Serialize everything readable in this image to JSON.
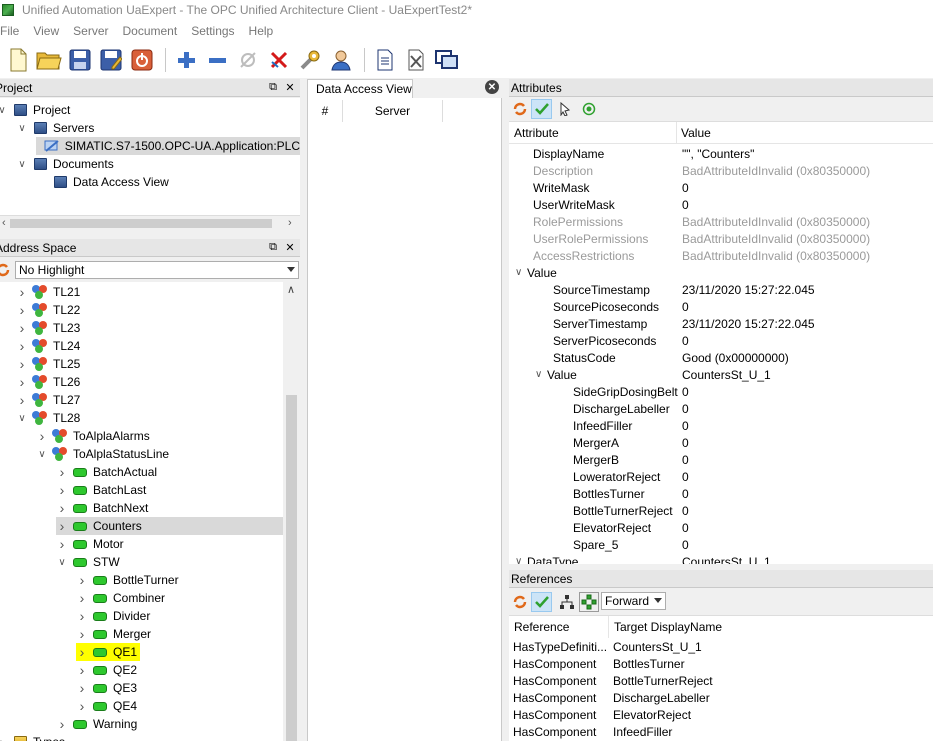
{
  "window": {
    "title": "Unified Automation UaExpert - The OPC Unified Architecture Client - UaExpertTest2*"
  },
  "menu": [
    "File",
    "View",
    "Server",
    "Document",
    "Settings",
    "Help"
  ],
  "toolbar": {
    "icons": [
      "new-document-icon",
      "open-folder-icon",
      "save-icon",
      "save-as-icon",
      "quit-icon",
      "add-server-icon",
      "remove-server-icon",
      "connect-icon",
      "disconnect-icon",
      "settings-wrench-icon",
      "user-icon",
      "document-properties-icon",
      "delete-document-icon",
      "windows-icon"
    ]
  },
  "project": {
    "title": "Project",
    "rows": [
      {
        "label": "Project",
        "level": 0,
        "expanded": true
      },
      {
        "label": "Servers",
        "level": 1,
        "expanded": true
      },
      {
        "label": "SIMATIC.S7-1500.OPC-UA.Application:PLC",
        "level": 2,
        "selected": true
      },
      {
        "label": "Documents",
        "level": 1,
        "expanded": true
      },
      {
        "label": "Data Access View",
        "level": 2
      }
    ]
  },
  "address_space": {
    "title": "Address Space",
    "highlight": "No Highlight",
    "rows": [
      {
        "label": "TL21",
        "level": 1,
        "type": "object"
      },
      {
        "label": "TL22",
        "level": 1,
        "type": "object"
      },
      {
        "label": "TL23",
        "level": 1,
        "type": "object"
      },
      {
        "label": "TL24",
        "level": 1,
        "type": "object"
      },
      {
        "label": "TL25",
        "level": 1,
        "type": "object"
      },
      {
        "label": "TL26",
        "level": 1,
        "type": "object"
      },
      {
        "label": "TL27",
        "level": 1,
        "type": "object"
      },
      {
        "label": "TL28",
        "level": 1,
        "type": "object",
        "expanded": true
      },
      {
        "label": "ToAlplaAlarms",
        "level": 2,
        "type": "object"
      },
      {
        "label": "ToAlplaStatusLine",
        "level": 2,
        "type": "object",
        "expanded": true
      },
      {
        "label": "BatchActual",
        "level": 3,
        "type": "variable"
      },
      {
        "label": "BatchLast",
        "level": 3,
        "type": "variable"
      },
      {
        "label": "BatchNext",
        "level": 3,
        "type": "variable"
      },
      {
        "label": "Counters",
        "level": 3,
        "type": "variable",
        "selected": true
      },
      {
        "label": "Motor",
        "level": 3,
        "type": "variable"
      },
      {
        "label": "STW",
        "level": 3,
        "type": "variable",
        "expanded": true
      },
      {
        "label": "BottleTurner",
        "level": 4,
        "type": "variable"
      },
      {
        "label": "Combiner",
        "level": 4,
        "type": "variable"
      },
      {
        "label": "Divider",
        "level": 4,
        "type": "variable"
      },
      {
        "label": "Merger",
        "level": 4,
        "type": "variable"
      },
      {
        "label": "QE1",
        "level": 4,
        "type": "variable",
        "highlighted": true
      },
      {
        "label": "QE2",
        "level": 4,
        "type": "variable"
      },
      {
        "label": "QE3",
        "level": 4,
        "type": "variable"
      },
      {
        "label": "QE4",
        "level": 4,
        "type": "variable"
      },
      {
        "label": "Warning",
        "level": 3,
        "type": "variable"
      },
      {
        "label": "Types",
        "level": 0,
        "type": "folder"
      }
    ]
  },
  "data_access": {
    "tab": "Data Access View",
    "columns": [
      "#",
      "Server"
    ]
  },
  "attributes": {
    "title": "Attributes",
    "col_attribute": "Attribute",
    "col_value": "Value",
    "rows": [
      {
        "name": "DisplayName",
        "value": "\"\", \"Counters\"",
        "indent": 0
      },
      {
        "name": "Description",
        "value": "BadAttributeIdInvalid (0x80350000)",
        "indent": 0,
        "grey": true
      },
      {
        "name": "WriteMask",
        "value": "0",
        "indent": 0
      },
      {
        "name": "UserWriteMask",
        "value": "0",
        "indent": 0
      },
      {
        "name": "RolePermissions",
        "value": "BadAttributeIdInvalid (0x80350000)",
        "indent": 0,
        "grey": true
      },
      {
        "name": "UserRolePermissions",
        "value": "BadAttributeIdInvalid (0x80350000)",
        "indent": 0,
        "grey": true
      },
      {
        "name": "AccessRestrictions",
        "value": "BadAttributeIdInvalid (0x80350000)",
        "indent": 0,
        "grey": true
      },
      {
        "name": "Value",
        "value": "",
        "indent": 0,
        "group": true
      },
      {
        "name": "SourceTimestamp",
        "value": "23/11/2020 15:27:22.045",
        "indent": 1
      },
      {
        "name": "SourcePicoseconds",
        "value": "0",
        "indent": 1
      },
      {
        "name": "ServerTimestamp",
        "value": "23/11/2020 15:27:22.045",
        "indent": 1
      },
      {
        "name": "ServerPicoseconds",
        "value": "0",
        "indent": 1
      },
      {
        "name": "StatusCode",
        "value": "Good (0x00000000)",
        "indent": 1
      },
      {
        "name": "Value",
        "value": "CountersSt_U_1",
        "indent": 1,
        "group": true
      },
      {
        "name": "SideGripDosingBelt",
        "value": "0",
        "indent": 2
      },
      {
        "name": "DischargeLabeller",
        "value": "0",
        "indent": 2
      },
      {
        "name": "InfeedFiller",
        "value": "0",
        "indent": 2
      },
      {
        "name": "MergerA",
        "value": "0",
        "indent": 2
      },
      {
        "name": "MergerB",
        "value": "0",
        "indent": 2
      },
      {
        "name": "LoweratorReject",
        "value": "0",
        "indent": 2
      },
      {
        "name": "BottlesTurner",
        "value": "0",
        "indent": 2
      },
      {
        "name": "BottleTurnerReject",
        "value": "0",
        "indent": 2
      },
      {
        "name": "ElevatorReject",
        "value": "0",
        "indent": 2
      },
      {
        "name": "Spare_5",
        "value": "0",
        "indent": 2
      },
      {
        "name": "DataType",
        "value": "CountersSt_U_1",
        "indent": 0,
        "group": true
      }
    ]
  },
  "references": {
    "title": "References",
    "direction": "Forward",
    "col_reference": "Reference",
    "col_target": "Target DisplayName",
    "rows": [
      {
        "reference": "HasTypeDefiniti...",
        "target": "CountersSt_U_1"
      },
      {
        "reference": "HasComponent",
        "target": "BottlesTurner"
      },
      {
        "reference": "HasComponent",
        "target": "BottleTurnerReject"
      },
      {
        "reference": "HasComponent",
        "target": "DischargeLabeller"
      },
      {
        "reference": "HasComponent",
        "target": "ElevatorReject"
      },
      {
        "reference": "HasComponent",
        "target": "InfeedFiller"
      }
    ]
  },
  "colors": {
    "selected_row": "#d9d9d9",
    "highlight_row": "#ffff00",
    "variable_green": "#2ec82e",
    "panel_header": "#e6e6e6"
  }
}
